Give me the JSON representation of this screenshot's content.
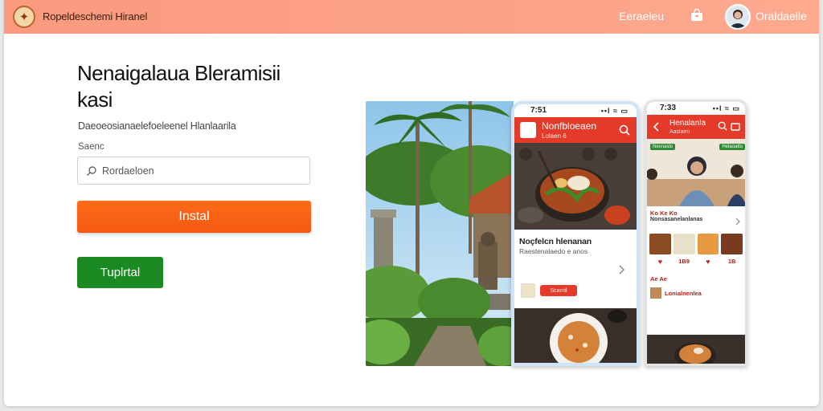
{
  "header": {
    "app_title": "Ropeldeschemi Hiranel",
    "nav_link": "Eeraeleu",
    "user_name": "Oraldaelle"
  },
  "hero": {
    "headline": "Nenaigalaua Bleramisii kasi",
    "subtitle": "Daeoeosianaelefoeleenel Hlanlaarila",
    "field_label": "Saenc",
    "search_placeholder": "Rordaeloen",
    "install_label": "Instal",
    "secondary_label": "Tuplrtal"
  },
  "phone_left": {
    "time": "7:51",
    "signal": "••l ≈ ▭",
    "header_title": "Nonfbloeaen",
    "header_sub": "Lolaen 6",
    "card_title": "Noçfelcn hlenanan",
    "card_sub": "Raestenalaedo e anos",
    "order_label": "Scantil"
  },
  "phone_right": {
    "time": "7:33",
    "signal": "••l ≈ ▭",
    "header_title": "Henalanla",
    "header_sub": "Aaslaen",
    "tag_left": "Nesnaslo",
    "tag_right": "Helaoatto",
    "section_title": "Ko Ke Ko",
    "section_sub": "Nonsasanelanlanas",
    "food_prices": [
      "",
      "1B9",
      "",
      "1B"
    ],
    "list_title": "Ae Ae",
    "list_item": "Lonialnenlea"
  },
  "colors": {
    "header_gradient_start": "#fb9a7e",
    "install_orange": "#f45a10",
    "secondary_green": "#1c8a22",
    "app_red": "#e5392a"
  }
}
